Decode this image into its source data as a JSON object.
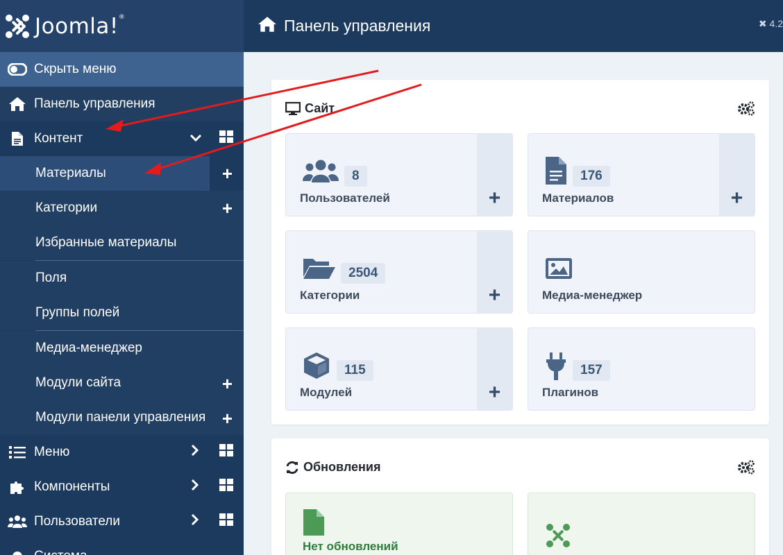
{
  "logo": {
    "text": "Joomla!",
    "reg": "®"
  },
  "header": {
    "title": "Панель управления",
    "version": "4.2"
  },
  "sidebar": {
    "hide_menu": "Скрыть меню",
    "dashboard": "Панель управления",
    "content": "Контент",
    "content_items": [
      {
        "label": "Материалы"
      },
      {
        "label": "Категории"
      },
      {
        "label": "Избранные материалы"
      },
      {
        "label": "Поля"
      },
      {
        "label": "Группы полей"
      },
      {
        "label": "Медиа-менеджер"
      },
      {
        "label": "Модули сайта"
      },
      {
        "label": "Модули панели управления"
      }
    ],
    "menus": "Меню",
    "components": "Компоненты",
    "users": "Пользователи",
    "system": "Система"
  },
  "site": {
    "title": "Сайт",
    "tiles": [
      {
        "label": "Пользователей",
        "count": "8",
        "icon": "users-icon"
      },
      {
        "label": "Материалов",
        "count": "176",
        "icon": "file-icon"
      },
      {
        "label": "Категории",
        "count": "2504",
        "icon": "folder-icon"
      },
      {
        "label": "Медиа-менеджер",
        "count": "",
        "icon": "image-icon"
      },
      {
        "label": "Модулей",
        "count": "115",
        "icon": "cube-icon"
      },
      {
        "label": "Плагинов",
        "count": "157",
        "icon": "plug-icon"
      }
    ],
    "add_symbol": "+"
  },
  "updates": {
    "title": "Обновления",
    "tiles": [
      {
        "label": "Нет обновлений",
        "icon": "file-icon"
      },
      {
        "label": "",
        "icon": "joomla-icon"
      }
    ]
  },
  "colors": {
    "sidebar": "#1b3a5e",
    "accent": "#3f6391",
    "arrow": "#e21c1c",
    "update_green": "#4c9a55"
  }
}
